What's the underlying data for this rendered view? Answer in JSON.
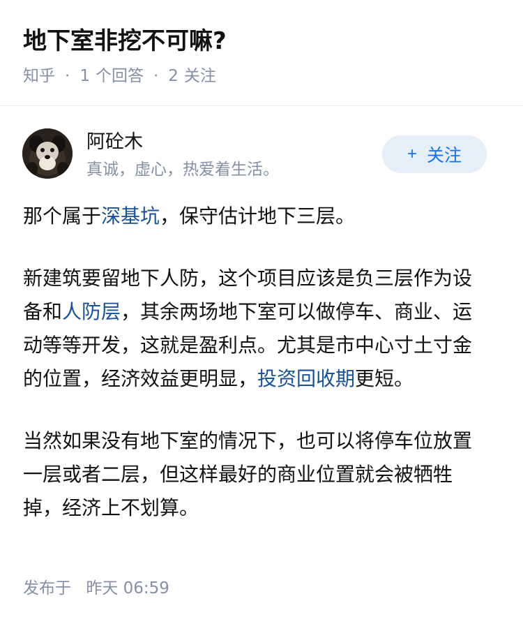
{
  "question": {
    "title": "地下室非挖不可嘛?",
    "source": "知乎",
    "separator": "·",
    "answer_count": "1",
    "answer_label": "个回答",
    "follower_count": "2",
    "follower_label": "关注"
  },
  "author": {
    "name": "阿砼木",
    "bio": "真诚，虚心，热爱着生活。",
    "follow_button": {
      "icon": "plus-icon",
      "icon_glyph": "+",
      "label": "关注"
    }
  },
  "answer": {
    "p1": {
      "t1": "那个属于",
      "link": "深基坑",
      "t2": "，保守估计地下三层。"
    },
    "p2": {
      "t1": "新建筑要留地下人防，这个项目应该是负三层作为设备和",
      "link1": "人防层",
      "t2": "，其余两场地下室可以做停车、商业、运动等等开发，这就是盈利点。尤其是市中心寸土寸金的位置，经济效益更明显，",
      "link2": "投资回收期",
      "t3": "更短。"
    },
    "p3": {
      "t1": "当然如果没有地下室的情况下，也可以将停车位放置一层或者二层，但这样最好的商业位置就会被牺牲掉，经济上不划算。"
    }
  },
  "footer": {
    "label": "发布于",
    "time": "昨天 06:59"
  },
  "colors": {
    "link": "#175199",
    "meta_gray": "#8590a6",
    "follow_bg": "#e5eff9",
    "follow_text": "#1772f6"
  }
}
